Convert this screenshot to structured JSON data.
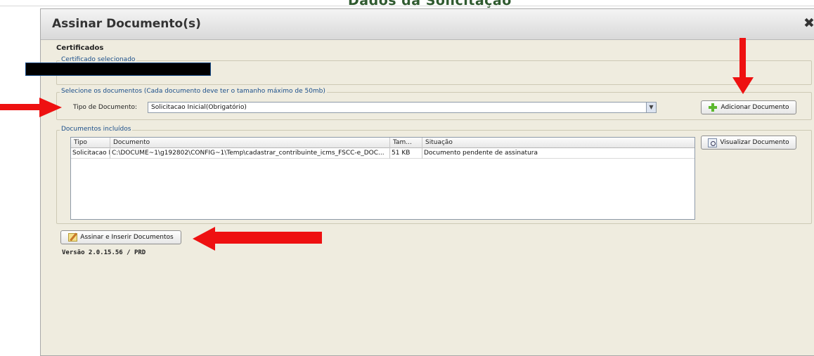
{
  "background_title": "Dados da Solicitação",
  "dialog": {
    "title": "Assinar Documento(s)",
    "close_glyph": "✖"
  },
  "certificados": {
    "section_label": "Certificados",
    "selected_legend": "Certificado selecionado"
  },
  "select_docs": {
    "legend": "Selecione os documentos (Cada documento deve ter o tamanho máximo de 50mb)",
    "type_label": "Tipo de Documento:",
    "type_value": "Solicitacao Inicial(Obrigatório)",
    "add_button_label": "Adicionar Documento"
  },
  "included_docs": {
    "legend": "Documentos incluídos",
    "columns": [
      "Tipo",
      "Documento",
      "Tam...",
      "Situação"
    ],
    "rows": [
      {
        "tipo": "Solicitacao I...",
        "documento": "C:\\DOCUME~1\\g192802\\CONFIG~1\\Temp\\cadastrar_contribuinte_icms_FSCC-e_DOC...",
        "tamanho": "51 KB",
        "situacao": "Documento pendente de assinatura"
      }
    ],
    "view_button_label": "Visualizar Documento"
  },
  "sign_button_label": "Assinar e Inserir Documentos",
  "version": "Versão 2.0.15.56 / PRD",
  "colors": {
    "dialog_bg": "#efecdf",
    "legend_text": "#1a4e8a",
    "annotation_arrow": "#ee1111"
  }
}
